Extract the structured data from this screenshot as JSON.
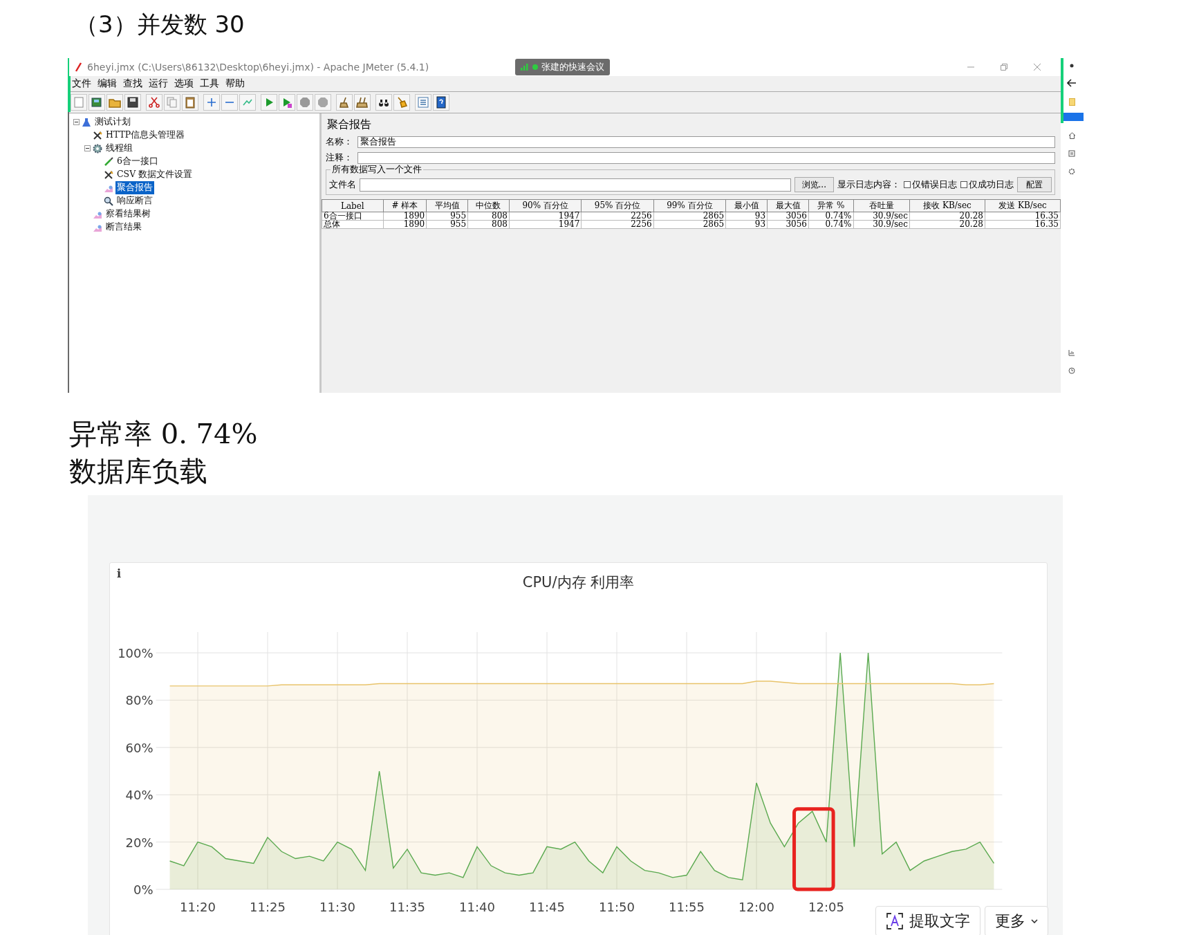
{
  "heading": "（3）并发数 30",
  "jmeter": {
    "window": {
      "title": "6heyi.jmx (C:\\Users\\86132\\Desktop\\6heyi.jmx) - Apache JMeter (5.4.1)"
    },
    "meeting_badge": "张建的快速会议",
    "menu": [
      "文件",
      "编辑",
      "查找",
      "运行",
      "选项",
      "工具",
      "帮助"
    ],
    "tree": [
      {
        "label": "测试计划",
        "kind": "plan",
        "selected": false,
        "expanded": true,
        "children": [
          {
            "label": "HTTP信息头管理器",
            "kind": "config",
            "selected": false
          },
          {
            "label": "线程组",
            "kind": "threads",
            "selected": false,
            "expanded": true,
            "children": [
              {
                "label": "6合一接口",
                "kind": "sampler",
                "selected": false
              },
              {
                "label": "CSV 数据文件设置",
                "kind": "config",
                "selected": false
              },
              {
                "label": "聚合报告",
                "kind": "listener",
                "selected": true
              },
              {
                "label": "响应断言",
                "kind": "assertion",
                "selected": false
              }
            ]
          },
          {
            "label": "察看结果树",
            "kind": "listener",
            "selected": false
          },
          {
            "label": "断言结果",
            "kind": "listener",
            "selected": false
          }
        ]
      }
    ],
    "panel": {
      "title": "聚合报告",
      "name_label": "名称：",
      "name_value": "聚合报告",
      "comment_label": "注释：",
      "file_group": "所有数据写入一个文件",
      "file_label": "文件名",
      "browse": "浏览...",
      "log_label": "显示日志内容：",
      "checkboxes": [
        {
          "label": "仅错误日志",
          "checked": false
        },
        {
          "label": "仅成功日志",
          "checked": false
        }
      ],
      "config": "配置"
    },
    "table": {
      "columns": [
        "Label",
        "# 样本",
        "平均值",
        "中位数",
        "90% 百分位",
        "95% 百分位",
        "99% 百分位",
        "最小值",
        "最大值",
        "异常 %",
        "吞吐量",
        "接收 KB/sec",
        "发送 KB/sec"
      ],
      "rows": [
        [
          "6合一接口",
          "1890",
          "955",
          "808",
          "1947",
          "2256",
          "2865",
          "93",
          "3056",
          "0.74%",
          "30.9/sec",
          "20.28",
          "16.35"
        ],
        [
          "总体",
          "1890",
          "955",
          "808",
          "1947",
          "2256",
          "2865",
          "93",
          "3056",
          "0.74%",
          "30.9/sec",
          "20.28",
          "16.35"
        ]
      ]
    }
  },
  "summary": [
    "异常率 0. 74%",
    "数据库负载"
  ],
  "chart_panel": {
    "info": "i",
    "chart_data": {
      "type": "area",
      "title": "CPU/内存 利用率",
      "categories": [
        null,
        null,
        "11:20",
        null,
        null,
        null,
        null,
        "11:25",
        null,
        null,
        null,
        null,
        "11:30",
        null,
        null,
        null,
        null,
        "11:35",
        null,
        null,
        null,
        null,
        "11:40",
        null,
        null,
        null,
        null,
        "11:45",
        null,
        null,
        null,
        null,
        "11:50",
        null,
        null,
        null,
        null,
        "11:55",
        null,
        null,
        null,
        null,
        "12:00",
        null,
        null,
        null,
        null,
        "12:05",
        null,
        null,
        null,
        null,
        null,
        null,
        null,
        null,
        null,
        null,
        null,
        null
      ],
      "series": [
        {
          "color": "#5aa94f",
          "values": [
            12,
            10,
            20,
            18,
            13,
            12,
            11,
            22,
            16,
            13,
            14,
            12,
            20,
            17,
            8,
            50,
            9,
            17,
            7,
            6,
            7,
            5,
            18,
            10,
            7,
            6,
            7,
            18,
            17,
            20,
            12,
            7,
            18,
            12,
            8,
            7,
            5,
            6,
            16,
            8,
            5,
            4,
            45,
            28,
            18,
            28,
            33,
            20,
            100,
            18,
            100,
            15,
            20,
            8,
            12,
            14,
            16,
            17,
            20,
            11
          ]
        },
        {
          "color": "#e8c36a",
          "values": [
            86,
            86,
            86,
            86,
            86,
            86,
            86,
            86,
            86.5,
            86.5,
            86.5,
            86.5,
            86.5,
            86.5,
            86.5,
            87,
            87,
            87,
            87,
            87,
            87,
            87,
            87,
            87,
            87,
            87,
            87,
            87,
            87,
            87,
            87,
            87,
            87,
            87,
            87,
            87,
            87,
            87,
            87,
            87,
            87,
            87,
            88,
            88,
            87.5,
            87,
            87,
            87,
            87,
            87,
            87,
            87,
            87,
            87,
            87,
            87,
            87,
            86.5,
            86.5,
            87
          ]
        }
      ],
      "ylim": [
        0,
        100
      ],
      "grid": true,
      "yticks": [
        {
          "value": 0,
          "label": "0%"
        },
        {
          "value": 20,
          "label": "20%"
        },
        {
          "value": 40,
          "label": "40%"
        },
        {
          "value": 60,
          "label": "60%"
        },
        {
          "value": 80,
          "label": "80%"
        },
        {
          "value": 100,
          "label": "100%"
        }
      ]
    }
  },
  "overlay_buttons": [
    {
      "kind": "extract",
      "label": "提取文字"
    },
    {
      "kind": "more",
      "label": "更多"
    }
  ]
}
